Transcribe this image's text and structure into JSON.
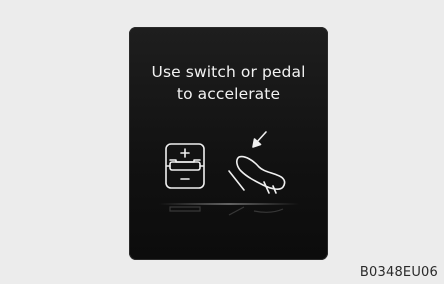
{
  "display": {
    "message_line1": "Use switch or pedal",
    "message_line2": "to accelerate"
  },
  "icons": {
    "switch": "cruise-switch-icon",
    "pedal": "accelerator-pedal-icon",
    "arrow": "press-arrow-icon"
  },
  "figure_code": "B0348EU06"
}
